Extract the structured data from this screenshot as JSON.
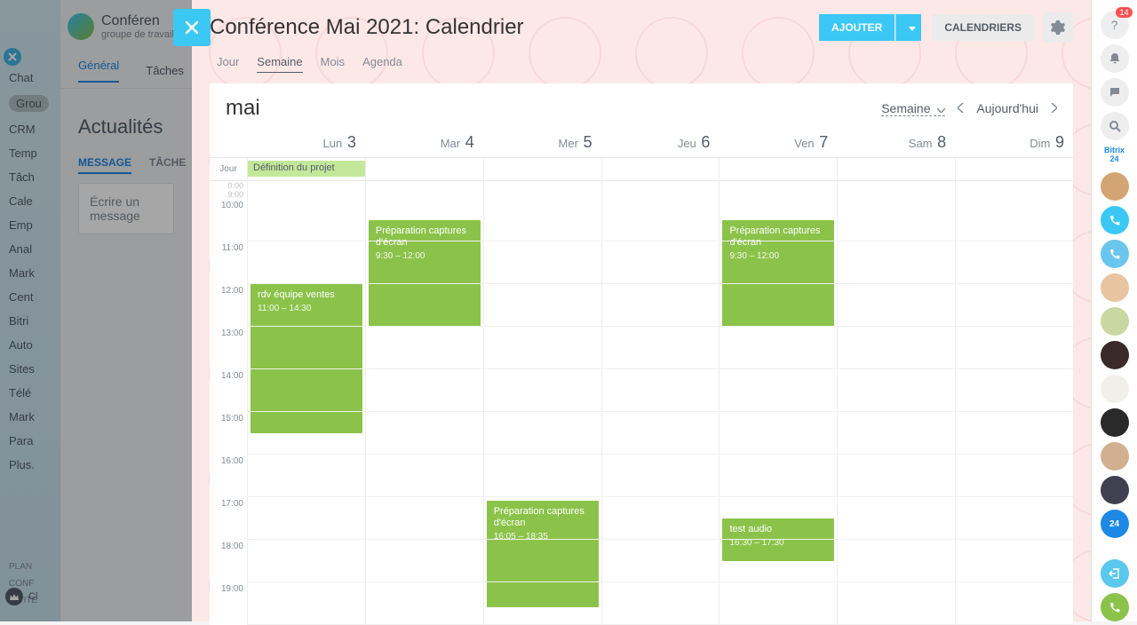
{
  "bg": {
    "brand": "Cie",
    "nav": [
      "Chat",
      "Grou",
      "CRM",
      "Temp",
      "Tâch",
      "Cale",
      "Emp",
      "Anal",
      "Mark",
      "Cent",
      "Bitri",
      "Auto",
      "Sites",
      "Télé",
      "Mark",
      "Para",
      "Plus."
    ],
    "bottom": [
      "PLAN",
      "CONF",
      "INVITE"
    ],
    "workgroup": {
      "title": "Conféren",
      "sub": "groupe de travail"
    },
    "tabs": {
      "general": "Général",
      "tasks": "Tâches"
    },
    "feed": {
      "heading": "Actualités",
      "tab_msg": "MESSAGE",
      "tab_task": "TÂCHE",
      "input_placeholder": "Écrire un message"
    },
    "crown_label": "Cl"
  },
  "panel": {
    "title": "Conférence Mai 2021: Calendrier",
    "btn_add": "AJOUTER",
    "btn_cal": "CALENDRIERS",
    "views": {
      "day": "Jour",
      "week": "Semaine",
      "month": "Mois",
      "agenda": "Agenda"
    }
  },
  "calendar": {
    "month": "mai",
    "view_label": "Semaine",
    "today": "Aujourd'hui",
    "allday_label": "Jour",
    "days": [
      {
        "label": "Lun",
        "num": "3"
      },
      {
        "label": "Mar",
        "num": "4"
      },
      {
        "label": "Mer",
        "num": "5"
      },
      {
        "label": "Jeu",
        "num": "6"
      },
      {
        "label": "Ven",
        "num": "7"
      },
      {
        "label": "Sam",
        "num": "8"
      },
      {
        "label": "Dim",
        "num": "9"
      }
    ],
    "time_start_top": "0:00",
    "time_start_bottom": "9:00",
    "hours": [
      "10:00",
      "11:00",
      "12:00",
      "13:00",
      "14:00",
      "15:00",
      "16:00",
      "17:00",
      "18:00",
      "19:00"
    ],
    "allday_event": {
      "title": "Définition du projet"
    },
    "events": {
      "lun": {
        "title": "rdv équipe ventes",
        "time": "11:00 – 14:30"
      },
      "mar": {
        "title": "Préparation captures d'écran",
        "time": "9:30 – 12:00"
      },
      "mer": {
        "title": "Préparation captures d'écran",
        "time": "16:05 – 18:35"
      },
      "ven1": {
        "title": "Préparation captures d'écran",
        "time": "9:30 – 12:00"
      },
      "ven2": {
        "title": "test audio",
        "time": "16:30 – 17:30"
      }
    }
  },
  "right": {
    "badge": "14",
    "b24": "Bitrix 24"
  }
}
